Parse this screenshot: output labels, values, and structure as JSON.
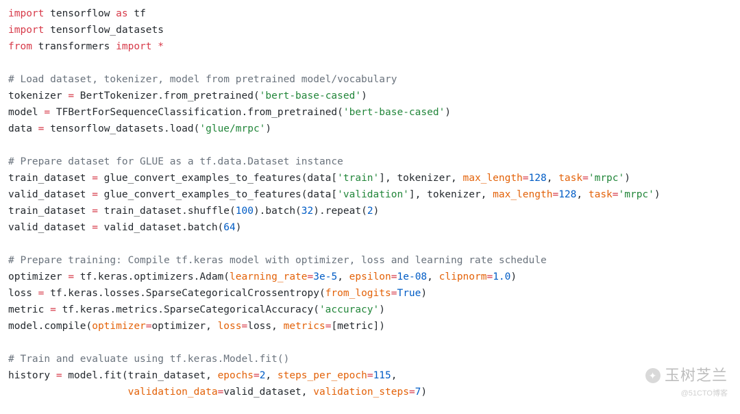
{
  "code": {
    "lines": [
      {
        "type": "code",
        "tokens": [
          {
            "t": "import",
            "c": "red"
          },
          {
            "t": " tensorflow ",
            "c": "black"
          },
          {
            "t": "as",
            "c": "red"
          },
          {
            "t": " tf",
            "c": "black"
          }
        ]
      },
      {
        "type": "code",
        "tokens": [
          {
            "t": "import",
            "c": "red"
          },
          {
            "t": " tensorflow_datasets",
            "c": "black"
          }
        ]
      },
      {
        "type": "code",
        "tokens": [
          {
            "t": "from",
            "c": "red"
          },
          {
            "t": " transformers ",
            "c": "black"
          },
          {
            "t": "import",
            "c": "red"
          },
          {
            "t": " ",
            "c": "black"
          },
          {
            "t": "*",
            "c": "red"
          }
        ]
      },
      {
        "type": "blank"
      },
      {
        "type": "comment",
        "text": "# Load dataset, tokenizer, model from pretrained model/vocabulary"
      },
      {
        "type": "code",
        "tokens": [
          {
            "t": "tokenizer ",
            "c": "black"
          },
          {
            "t": "=",
            "c": "red"
          },
          {
            "t": " BertTokenizer.from_pretrained(",
            "c": "black"
          },
          {
            "t": "'bert-base-cased'",
            "c": "green"
          },
          {
            "t": ")",
            "c": "black"
          }
        ]
      },
      {
        "type": "code",
        "tokens": [
          {
            "t": "model ",
            "c": "black"
          },
          {
            "t": "=",
            "c": "red"
          },
          {
            "t": " TFBertForSequenceClassification.from_pretrained(",
            "c": "black"
          },
          {
            "t": "'bert-base-cased'",
            "c": "green"
          },
          {
            "t": ")",
            "c": "black"
          }
        ]
      },
      {
        "type": "code",
        "tokens": [
          {
            "t": "data ",
            "c": "black"
          },
          {
            "t": "=",
            "c": "red"
          },
          {
            "t": " tensorflow_datasets.load(",
            "c": "black"
          },
          {
            "t": "'glue/mrpc'",
            "c": "green"
          },
          {
            "t": ")",
            "c": "black"
          }
        ]
      },
      {
        "type": "blank"
      },
      {
        "type": "comment",
        "text": "# Prepare dataset for GLUE as a tf.data.Dataset instance"
      },
      {
        "type": "code",
        "tokens": [
          {
            "t": "train_dataset ",
            "c": "black"
          },
          {
            "t": "=",
            "c": "red"
          },
          {
            "t": " glue_convert_examples_to_features(data[",
            "c": "black"
          },
          {
            "t": "'train'",
            "c": "green"
          },
          {
            "t": "], tokenizer, ",
            "c": "black"
          },
          {
            "t": "max_length",
            "c": "orange"
          },
          {
            "t": "=",
            "c": "red"
          },
          {
            "t": "128",
            "c": "blue"
          },
          {
            "t": ", ",
            "c": "black"
          },
          {
            "t": "task",
            "c": "orange"
          },
          {
            "t": "=",
            "c": "red"
          },
          {
            "t": "'mrpc'",
            "c": "green"
          },
          {
            "t": ")",
            "c": "black"
          }
        ]
      },
      {
        "type": "code",
        "tokens": [
          {
            "t": "valid_dataset ",
            "c": "black"
          },
          {
            "t": "=",
            "c": "red"
          },
          {
            "t": " glue_convert_examples_to_features(data[",
            "c": "black"
          },
          {
            "t": "'validation'",
            "c": "green"
          },
          {
            "t": "], tokenizer, ",
            "c": "black"
          },
          {
            "t": "max_length",
            "c": "orange"
          },
          {
            "t": "=",
            "c": "red"
          },
          {
            "t": "128",
            "c": "blue"
          },
          {
            "t": ", ",
            "c": "black"
          },
          {
            "t": "task",
            "c": "orange"
          },
          {
            "t": "=",
            "c": "red"
          },
          {
            "t": "'mrpc'",
            "c": "green"
          },
          {
            "t": ")",
            "c": "black"
          }
        ]
      },
      {
        "type": "code",
        "tokens": [
          {
            "t": "train_dataset ",
            "c": "black"
          },
          {
            "t": "=",
            "c": "red"
          },
          {
            "t": " train_dataset.shuffle(",
            "c": "black"
          },
          {
            "t": "100",
            "c": "blue"
          },
          {
            "t": ").batch(",
            "c": "black"
          },
          {
            "t": "32",
            "c": "blue"
          },
          {
            "t": ").repeat(",
            "c": "black"
          },
          {
            "t": "2",
            "c": "blue"
          },
          {
            "t": ")",
            "c": "black"
          }
        ]
      },
      {
        "type": "code",
        "tokens": [
          {
            "t": "valid_dataset ",
            "c": "black"
          },
          {
            "t": "=",
            "c": "red"
          },
          {
            "t": " valid_dataset.batch(",
            "c": "black"
          },
          {
            "t": "64",
            "c": "blue"
          },
          {
            "t": ")",
            "c": "black"
          }
        ]
      },
      {
        "type": "blank"
      },
      {
        "type": "comment",
        "text": "# Prepare training: Compile tf.keras model with optimizer, loss and learning rate schedule"
      },
      {
        "type": "code",
        "tokens": [
          {
            "t": "optimizer ",
            "c": "black"
          },
          {
            "t": "=",
            "c": "red"
          },
          {
            "t": " tf.keras.optimizers.Adam(",
            "c": "black"
          },
          {
            "t": "learning_rate",
            "c": "orange"
          },
          {
            "t": "=",
            "c": "red"
          },
          {
            "t": "3e-5",
            "c": "blue"
          },
          {
            "t": ", ",
            "c": "black"
          },
          {
            "t": "epsilon",
            "c": "orange"
          },
          {
            "t": "=",
            "c": "red"
          },
          {
            "t": "1e-08",
            "c": "blue"
          },
          {
            "t": ", ",
            "c": "black"
          },
          {
            "t": "clipnorm",
            "c": "orange"
          },
          {
            "t": "=",
            "c": "red"
          },
          {
            "t": "1.0",
            "c": "blue"
          },
          {
            "t": ")",
            "c": "black"
          }
        ]
      },
      {
        "type": "code",
        "tokens": [
          {
            "t": "loss ",
            "c": "black"
          },
          {
            "t": "=",
            "c": "red"
          },
          {
            "t": " tf.keras.losses.SparseCategoricalCrossentropy(",
            "c": "black"
          },
          {
            "t": "from_logits",
            "c": "orange"
          },
          {
            "t": "=",
            "c": "red"
          },
          {
            "t": "True",
            "c": "blue"
          },
          {
            "t": ")",
            "c": "black"
          }
        ]
      },
      {
        "type": "code",
        "tokens": [
          {
            "t": "metric ",
            "c": "black"
          },
          {
            "t": "=",
            "c": "red"
          },
          {
            "t": " tf.keras.metrics.SparseCategoricalAccuracy(",
            "c": "black"
          },
          {
            "t": "'accuracy'",
            "c": "green"
          },
          {
            "t": ")",
            "c": "black"
          }
        ]
      },
      {
        "type": "code",
        "tokens": [
          {
            "t": "model.compile(",
            "c": "black"
          },
          {
            "t": "optimizer",
            "c": "orange"
          },
          {
            "t": "=",
            "c": "red"
          },
          {
            "t": "optimizer, ",
            "c": "black"
          },
          {
            "t": "loss",
            "c": "orange"
          },
          {
            "t": "=",
            "c": "red"
          },
          {
            "t": "loss, ",
            "c": "black"
          },
          {
            "t": "metrics",
            "c": "orange"
          },
          {
            "t": "=",
            "c": "red"
          },
          {
            "t": "[metric])",
            "c": "black"
          }
        ]
      },
      {
        "type": "blank"
      },
      {
        "type": "comment",
        "text": "# Train and evaluate using tf.keras.Model.fit()"
      },
      {
        "type": "code",
        "tokens": [
          {
            "t": "history ",
            "c": "black"
          },
          {
            "t": "=",
            "c": "red"
          },
          {
            "t": " model.fit(train_dataset, ",
            "c": "black"
          },
          {
            "t": "epochs",
            "c": "orange"
          },
          {
            "t": "=",
            "c": "red"
          },
          {
            "t": "2",
            "c": "blue"
          },
          {
            "t": ", ",
            "c": "black"
          },
          {
            "t": "steps_per_epoch",
            "c": "orange"
          },
          {
            "t": "=",
            "c": "red"
          },
          {
            "t": "115",
            "c": "blue"
          },
          {
            "t": ",",
            "c": "black"
          }
        ]
      },
      {
        "type": "code",
        "tokens": [
          {
            "t": "                    ",
            "c": "black"
          },
          {
            "t": "validation_data",
            "c": "orange"
          },
          {
            "t": "=",
            "c": "red"
          },
          {
            "t": "valid_dataset, ",
            "c": "black"
          },
          {
            "t": "validation_steps",
            "c": "orange"
          },
          {
            "t": "=",
            "c": "red"
          },
          {
            "t": "7",
            "c": "blue"
          },
          {
            "t": ")",
            "c": "black"
          }
        ]
      }
    ]
  },
  "watermark": {
    "main": "玉树芝兰",
    "sub": "@51CTO博客"
  }
}
